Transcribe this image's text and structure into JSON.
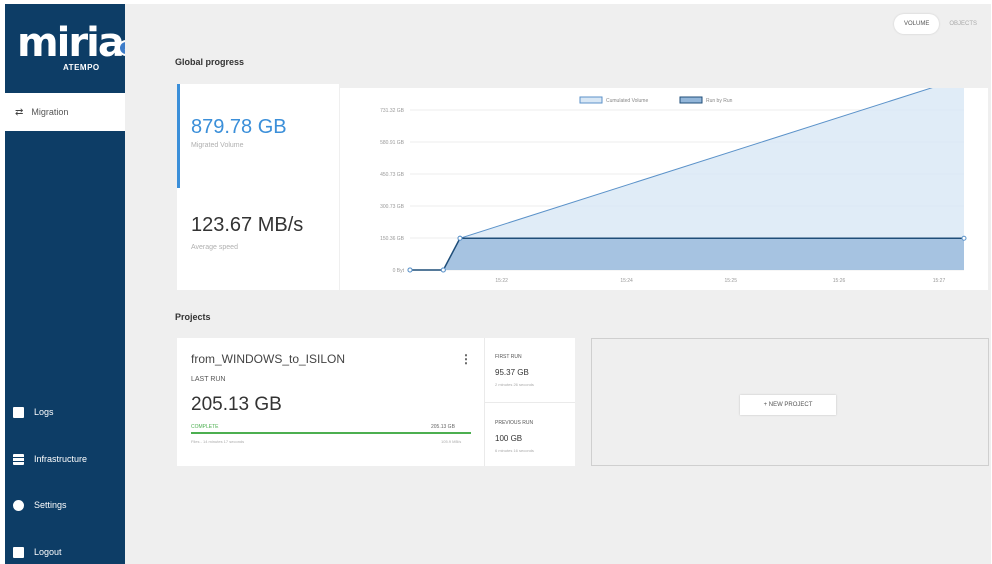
{
  "brand": {
    "logo": "miria",
    "sub": "ATEMPO",
    "collapse_icon": "chevron-left-icon"
  },
  "sidebar": {
    "active_item": {
      "label": "Migration",
      "icon": "swap-arrows-icon"
    },
    "items": [
      {
        "label": "Logs",
        "icon": "clipboard-icon"
      },
      {
        "label": "Infrastructure",
        "icon": "list-icon"
      },
      {
        "label": "Settings",
        "icon": "gear-icon"
      },
      {
        "label": "Logout",
        "icon": "logout-icon"
      }
    ]
  },
  "tabs": {
    "active": "VOLUME",
    "inactive": "OBJECTS"
  },
  "global_progress": {
    "title": "Global progress",
    "migrated_volume": "879.78 GB",
    "migrated_volume_label": "Migrated Volume",
    "average_speed": "123.67 MB/s",
    "average_speed_label": "Average speed"
  },
  "chart_data": {
    "type": "area",
    "legend": [
      "Cumulated Volume",
      "Run by Run"
    ],
    "legend_position": "top",
    "y_tick_labels": [
      "0 Byt",
      "150.36 GB",
      "300.73 GB",
      "450.73 GB",
      "580.91 GB",
      "731.32 GB"
    ],
    "x_tick_labels": [
      "15:22",
      "15:24",
      "15:25",
      "15:26",
      "15:27"
    ],
    "ylim": [
      0,
      731.32
    ],
    "series": [
      {
        "name": "Cumulated Volume",
        "color": "#d8e7f5",
        "x": [
          0,
          0.4,
          0.6,
          6.65
        ],
        "y": [
          0,
          0,
          145,
          879.78
        ]
      },
      {
        "name": "Run by Run",
        "color": "#93b6d9",
        "x": [
          0,
          0.4,
          0.6,
          6.65
        ],
        "y": [
          0,
          0,
          145,
          145
        ]
      }
    ]
  },
  "projects": {
    "title": "Projects",
    "cards": [
      {
        "name": "from_WINDOWS_to_ISILON",
        "last_run_label": "LAST RUN",
        "last_run_value": "205.13 GB",
        "status": "COMPLETE",
        "status_value": "205.13 GB",
        "progress": 1.0,
        "footer_left": "Files - 14 minutes 17 seconds",
        "footer_right": "105.9 MB/s",
        "first_run_label": "FIRST RUN",
        "first_run_value": "95.37 GB",
        "first_run_sub": "2 minutes 26 seconds",
        "previous_run_label": "PREVIOUS RUN",
        "previous_run_value": "100 GB",
        "previous_run_sub": "6 minutes 16 seconds"
      }
    ],
    "new_project_label": "+ NEW PROJECT"
  }
}
